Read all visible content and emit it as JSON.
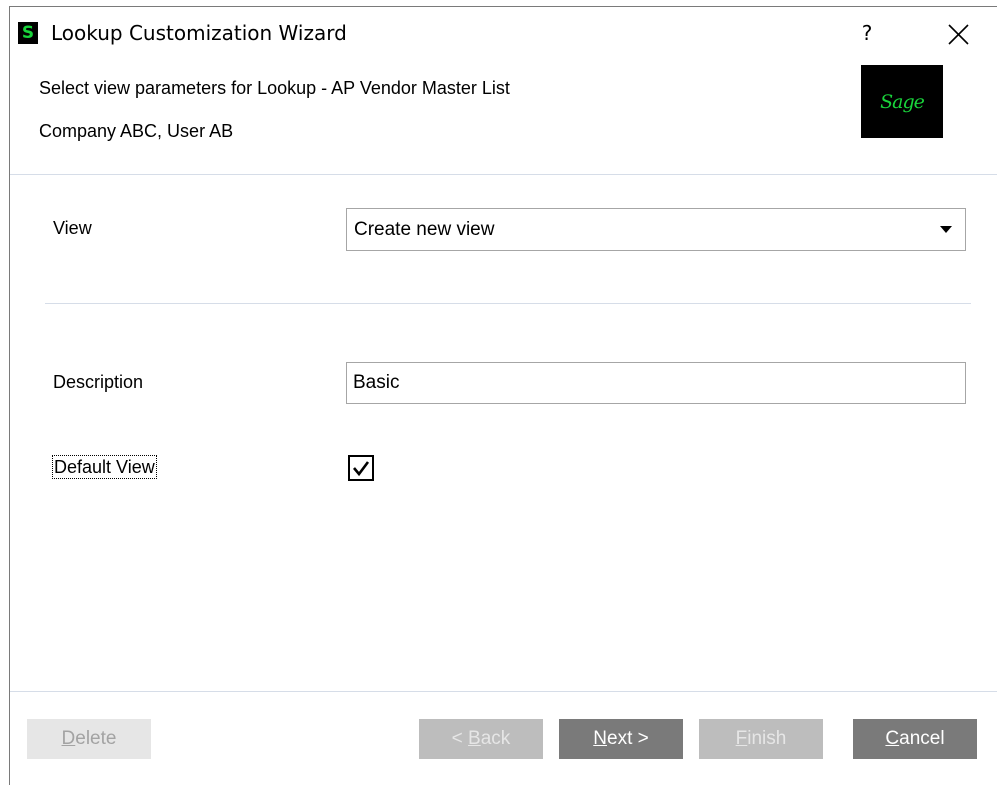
{
  "window": {
    "title": "Lookup Customization Wizard",
    "app_icon_letter": "S",
    "help_label": "?"
  },
  "header": {
    "subtitle": "Select view parameters for Lookup - AP Vendor Master List",
    "company_user": "Company ABC, User AB",
    "logo_text": "Sage"
  },
  "form": {
    "view_label": "View",
    "view_selected": "Create new view",
    "description_label": "Description",
    "description_value": "Basic",
    "default_view_label": "Default View",
    "default_view_checked": true
  },
  "buttons": {
    "delete": {
      "mnemonic": "D",
      "rest": "elete",
      "enabled": false
    },
    "back": {
      "prefix": "< ",
      "mnemonic": "B",
      "rest": "ack",
      "enabled": false
    },
    "next": {
      "mnemonic": "N",
      "rest": "ext >",
      "enabled": true
    },
    "finish": {
      "mnemonic": "F",
      "rest": "inish",
      "enabled": false
    },
    "cancel": {
      "mnemonic": "C",
      "rest": "ancel",
      "enabled": true
    }
  },
  "colors": {
    "brand_green": "#19d33b",
    "separator": "#d6dde8",
    "button_active": "#7a7a7a",
    "button_disabled": "#bdbdbd"
  }
}
